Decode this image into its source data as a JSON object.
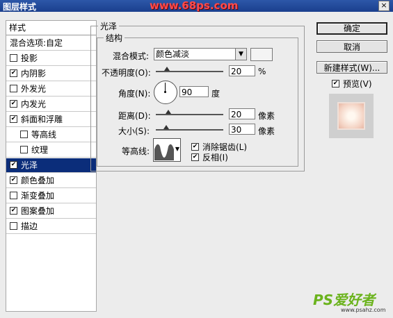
{
  "window": {
    "title": "图层样式",
    "watermark": "www.68ps.com",
    "close_label": "×"
  },
  "sidebar": {
    "header": "样式",
    "items": [
      {
        "label": "混合选项:自定",
        "checkbox": false,
        "checked": false,
        "indent": false
      },
      {
        "label": "投影",
        "checkbox": true,
        "checked": false,
        "indent": false
      },
      {
        "label": "内阴影",
        "checkbox": true,
        "checked": true,
        "indent": false
      },
      {
        "label": "外发光",
        "checkbox": true,
        "checked": false,
        "indent": false
      },
      {
        "label": "内发光",
        "checkbox": true,
        "checked": true,
        "indent": false
      },
      {
        "label": "斜面和浮雕",
        "checkbox": true,
        "checked": true,
        "indent": false
      },
      {
        "label": "等高线",
        "checkbox": true,
        "checked": false,
        "indent": true
      },
      {
        "label": "纹理",
        "checkbox": true,
        "checked": false,
        "indent": true
      },
      {
        "label": "光泽",
        "checkbox": true,
        "checked": true,
        "indent": false,
        "selected": true
      },
      {
        "label": "颜色叠加",
        "checkbox": true,
        "checked": true,
        "indent": false
      },
      {
        "label": "渐变叠加",
        "checkbox": true,
        "checked": false,
        "indent": false
      },
      {
        "label": "图案叠加",
        "checkbox": true,
        "checked": true,
        "indent": false
      },
      {
        "label": "描边",
        "checkbox": true,
        "checked": false,
        "indent": false
      }
    ]
  },
  "satin": {
    "group_title": "光泽",
    "structure_title": "结构",
    "blend_mode_label": "混合模式:",
    "blend_mode_value": "颜色减淡",
    "blend_color": "#f4f4f4",
    "opacity_label": "不透明度(O):",
    "opacity_value": "20",
    "opacity_unit": "%",
    "angle_label": "角度(N):",
    "angle_value": "90",
    "angle_unit": "度",
    "distance_label": "距离(D):",
    "distance_value": "20",
    "distance_unit": "像素",
    "size_label": "大小(S):",
    "size_value": "30",
    "size_unit": "像素",
    "contour_label": "等高线:",
    "antialias_label": "消除锯齿(L)",
    "antialias_checked": true,
    "invert_label": "反相(I)",
    "invert_checked": true
  },
  "buttons": {
    "ok": "确定",
    "cancel": "取消",
    "new_style": "新建样式(W)...",
    "preview_label": "预览(V)",
    "preview_checked": true
  },
  "logo": {
    "text": "PS爱好者",
    "url": "www.psahz.com"
  }
}
